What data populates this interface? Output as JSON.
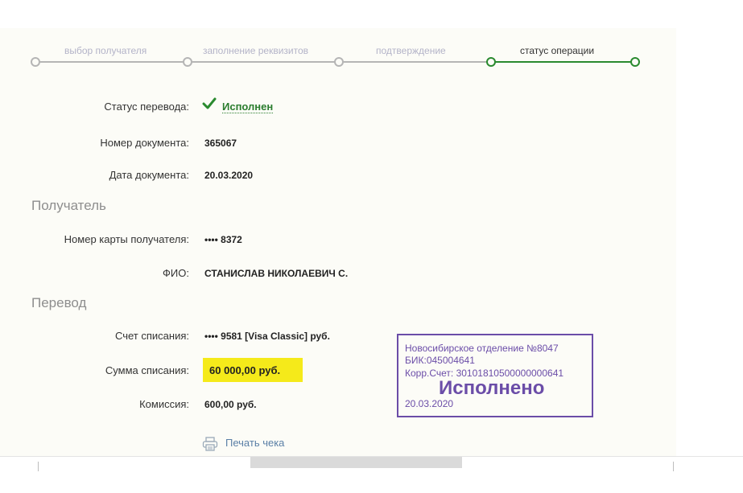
{
  "steps": [
    {
      "label": "выбор получателя"
    },
    {
      "label": "заполнение реквизитов"
    },
    {
      "label": "подтверждение"
    },
    {
      "label": "статус операции"
    }
  ],
  "status": {
    "label": "Статус перевода:",
    "value": "Исполнен",
    "icon": "checkmark-icon"
  },
  "document": {
    "number_label": "Номер документа:",
    "number": "365067",
    "date_label": "Дата документа:",
    "date": "20.03.2020"
  },
  "recipient": {
    "section_title": "Получатель",
    "card_label": "Номер карты получателя:",
    "card": "•••• 8372",
    "name_label": "ФИО:",
    "name": "СТАНИСЛАВ НИКОЛАЕВИЧ С."
  },
  "transfer": {
    "section_title": "Перевод",
    "account_label": "Счет списания:",
    "account": "•••• 9581  [Visa Classic]  руб.",
    "amount_label": "Сумма списания:",
    "amount": "60 000,00  руб.",
    "fee_label": "Комиссия:",
    "fee": "600,00 руб."
  },
  "stamp": {
    "line1": "Новосибирское отделение №8047",
    "line2": "БИК:045004641",
    "line3": "Корр.Счет: 30101810500000000641",
    "status": "Исполнено",
    "date": "20.03.2020"
  },
  "print_receipt": {
    "label": "Печать чека",
    "icon": "printer-icon"
  },
  "colors": {
    "accent": "#2a8a2f",
    "highlight": "#f5ea1a",
    "stamp": "#6b4da8",
    "link": "#5a7fa6"
  }
}
